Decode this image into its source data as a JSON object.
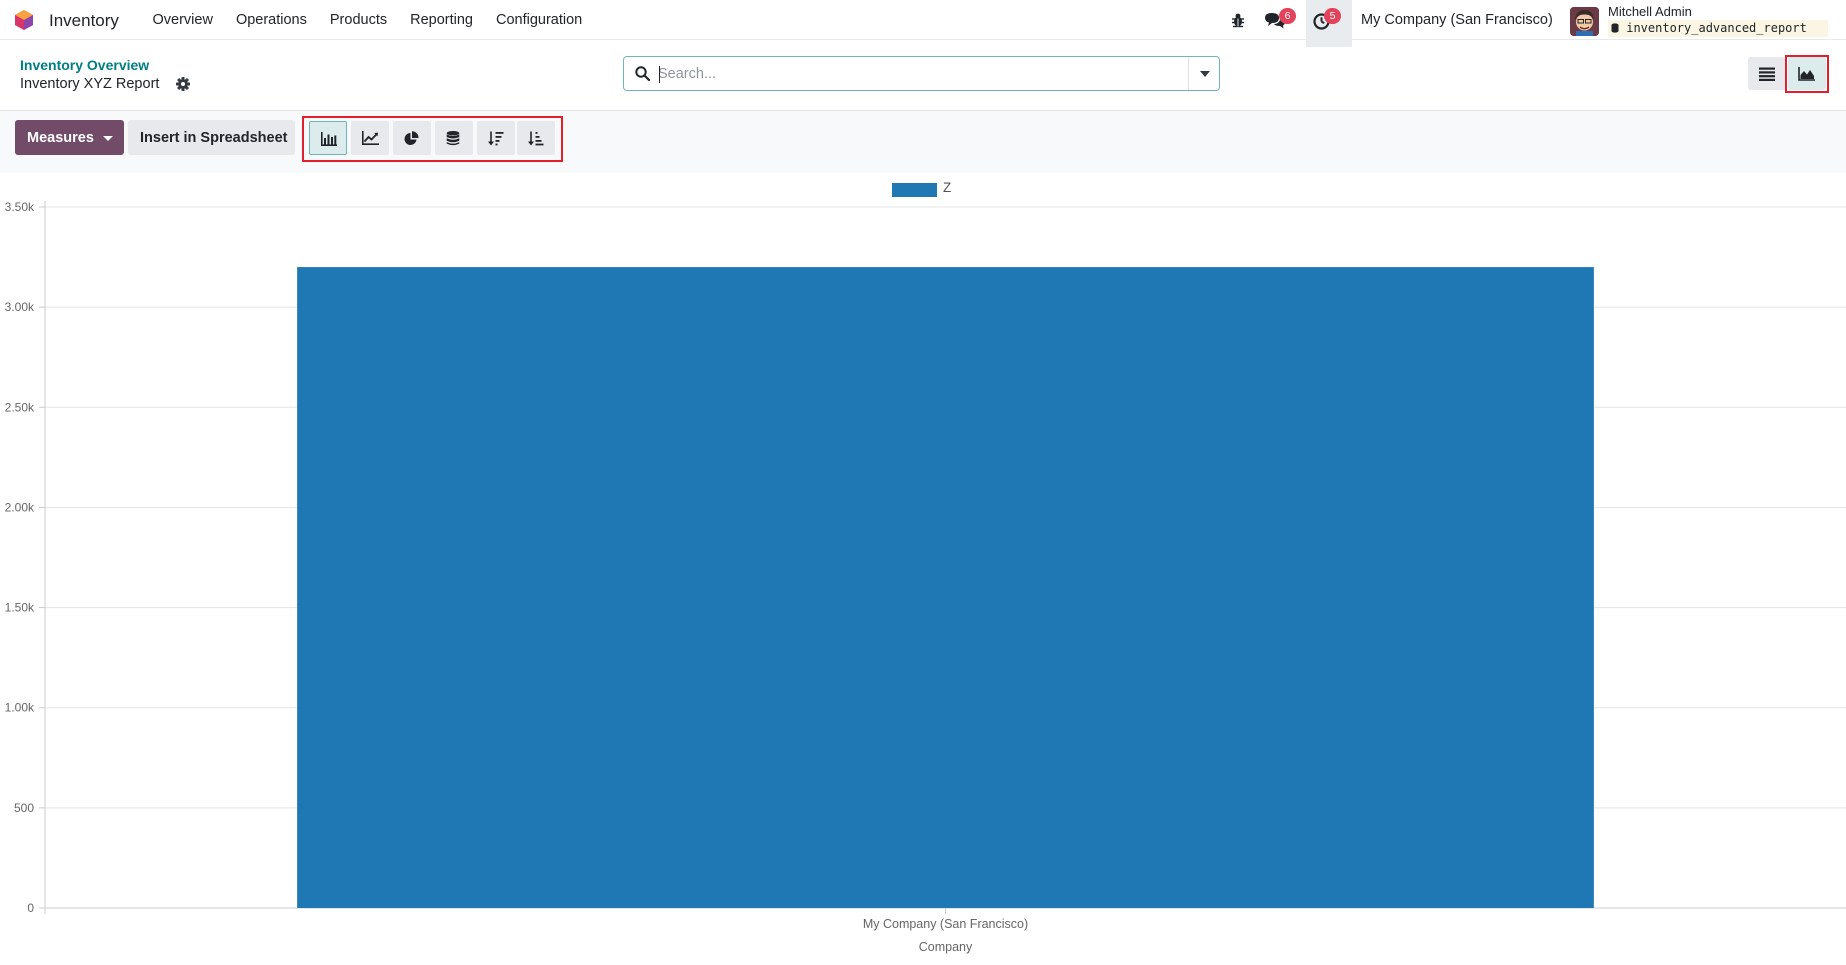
{
  "navbar": {
    "app_name": "Inventory",
    "menu": [
      "Overview",
      "Operations",
      "Products",
      "Reporting",
      "Configuration"
    ],
    "messages_count": "6",
    "activities_count": "5",
    "company": "My Company (San Francisco)",
    "user_name": "Mitchell Admin",
    "database": "inventory_advanced_report"
  },
  "control_panel": {
    "breadcrumb": "Inventory Overview",
    "title": "Inventory XYZ Report",
    "search_placeholder": "Search..."
  },
  "toolbar": {
    "measures_label": "Measures",
    "insert_label": "Insert in Spreadsheet",
    "chart_buttons": [
      "bar-chart",
      "line-chart",
      "pie-chart",
      "stacked",
      "descending",
      "ascending"
    ],
    "active_chart": "bar-chart"
  },
  "colors": {
    "brand": "#714b67",
    "accent": "#017e84",
    "series": "#1f77b4",
    "badge": "#e2435a",
    "highlight": "#e2202b"
  },
  "chart_data": {
    "type": "bar",
    "categories": [
      "My Company (San Francisco)"
    ],
    "series": [
      {
        "name": "Z",
        "values": [
          3200
        ]
      }
    ],
    "xlabel": "Company",
    "ylabel": "",
    "ylim": [
      0,
      3500
    ],
    "yticks": [
      0,
      500,
      1000,
      1500,
      2000,
      2500,
      3000,
      3500
    ],
    "ytick_labels": [
      "0",
      "500",
      "1.00k",
      "1.50k",
      "2.00k",
      "2.50k",
      "3.00k",
      "3.50k"
    ],
    "grid": true,
    "legend_position": "top-center"
  }
}
